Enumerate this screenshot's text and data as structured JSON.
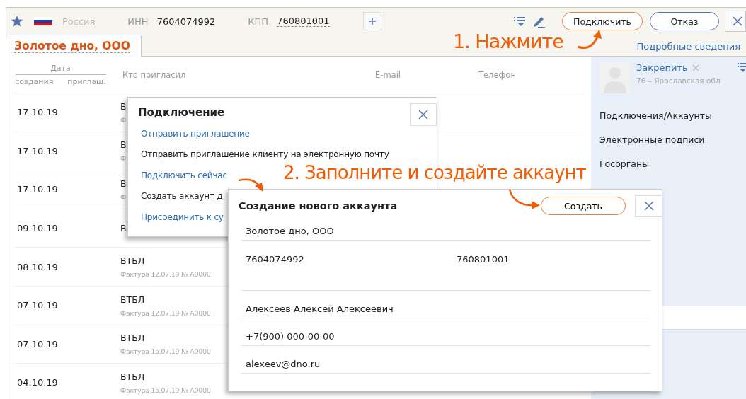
{
  "header": {
    "country": "Россия",
    "inn_label": "ИНН",
    "inn": "7604074992",
    "kpp_label": "КПП",
    "kpp": "760801001",
    "buttons": [
      {
        "label": "Подключить",
        "kind": "accent"
      },
      {
        "label": "Отказ",
        "kind": "plain"
      }
    ],
    "details_link": "Подробные сведения"
  },
  "tab": {
    "label": "Золотое дно, ООО"
  },
  "table": {
    "columns": {
      "date_group": "Дата",
      "date_created": "создания",
      "date_invited": "приглаш.",
      "inviter": "Кто пригласил",
      "email": "E-mail",
      "phone": "Телефон"
    },
    "rows": [
      {
        "date": "17.10.19",
        "name": "В",
        "note": "Ф"
      },
      {
        "date": "17.10.19",
        "name": "В",
        "note": "Ф"
      },
      {
        "date": "17.10.19",
        "name": "В",
        "note": "Ф"
      },
      {
        "date": "09.10.19",
        "name": "В"
      },
      {
        "date": "08.10.19",
        "name": "ВТБЛ",
        "note": "Фактура 12.07.19 № А0000"
      },
      {
        "date": "07.10.19",
        "name": "ВТБЛ",
        "note": "Фактура 12.07.19 № А0000"
      },
      {
        "date": "07.10.19",
        "name": "ВТБЛ",
        "note": "Фактура 15.07.19 № А0000"
      },
      {
        "date": "04.10.19",
        "name": "ВТБЛ",
        "note": "Фактура 15.07.19 № А0000"
      }
    ]
  },
  "sidebar": {
    "pin_link": "Закрепить",
    "region": "76 – Ярославская обл",
    "items": [
      "Подключения/Аккаунты",
      "Электронные подписи",
      "Госорганы"
    ]
  },
  "connect_popup": {
    "title": "Подключение",
    "options": [
      {
        "link": "Отправить приглашение",
        "description": "Отправить приглашение клиенту на электронную почту"
      },
      {
        "link": "Подключить сейчас",
        "description": "Создать аккаунт д"
      },
      {
        "link": "Присоединить к су"
      }
    ]
  },
  "account_dialog": {
    "title": "Создание нового аккаунта",
    "create_button": "Создать",
    "fields": [
      {
        "kind": "single",
        "values": [
          "Золотое дно, ООО"
        ]
      },
      {
        "kind": "pair",
        "values": [
          "7604074992",
          "760801001"
        ]
      },
      {
        "kind": "blank"
      },
      {
        "kind": "single",
        "values": [
          "Алексеев Алексей Алексеевич"
        ]
      },
      {
        "kind": "single",
        "values": [
          "+7(900) 000-00-00"
        ]
      },
      {
        "kind": "single",
        "values": [
          "alexeev@dno.ru"
        ]
      }
    ]
  },
  "annotations": [
    "1. Нажмите",
    "2. Заполните и создайте аккаунт"
  ]
}
